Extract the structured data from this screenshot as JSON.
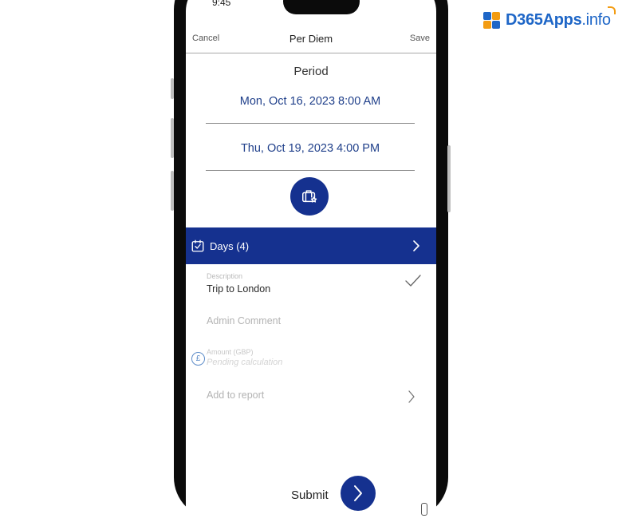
{
  "watermark": {
    "brand": "D365Apps",
    "tld": ".info"
  },
  "status_bar": {
    "time": "9:45"
  },
  "nav": {
    "cancel": "Cancel",
    "title": "Per Diem",
    "save": "Save"
  },
  "period": {
    "label": "Period",
    "start": "Mon, Oct 16, 2023 8:00 AM",
    "end": "Thu, Oct 19, 2023 4:00 PM"
  },
  "days": {
    "label": "Days (4)"
  },
  "description": {
    "label": "Description",
    "value": "Trip to London"
  },
  "admin_comment": {
    "placeholder": "Admin Comment"
  },
  "amount": {
    "label": "Amount (GBP)",
    "value": "Pending calculation"
  },
  "report": {
    "placeholder": "Add to report"
  },
  "submit": {
    "label": "Submit"
  },
  "colors": {
    "primary": "#15318f",
    "date_text": "#1f3f8a",
    "logo_blue": "#1e66c7",
    "logo_orange": "#f39c12"
  },
  "icons": [
    "calendar-check-icon",
    "luggage-star-icon",
    "chevron-right-icon",
    "checkmark-icon",
    "pound-currency-icon"
  ]
}
